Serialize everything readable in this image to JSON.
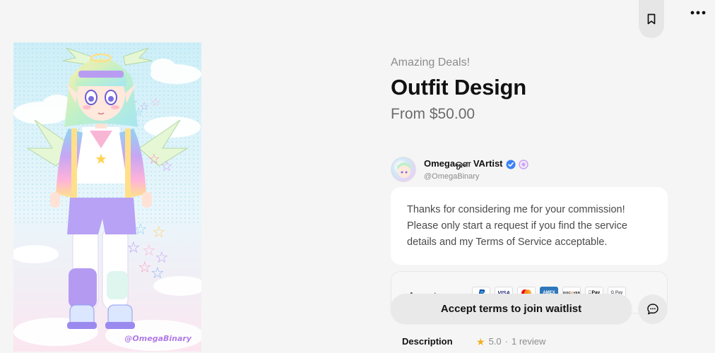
{
  "header": {
    "bookmark_icon": "bookmark-icon",
    "more_icon": "more-horizontal-icon"
  },
  "artwork": {
    "watermark": "@OmegaBinary"
  },
  "listing": {
    "eyebrow": "Amazing Deals!",
    "title": "Outfit Design",
    "price": "From $50.00"
  },
  "seller": {
    "name": "Omegaஔ VArtist",
    "handle": "@OmegaBinary",
    "verified_color": "#3b82f6",
    "badge_color": "#c9a2f2"
  },
  "message": {
    "line1": "Thanks for considering me for your commission!",
    "line2": "Please only start a request if you find the service",
    "line3": "details and my Terms of Service acceptable."
  },
  "accepts": {
    "label": "Accepts",
    "methods": [
      "PayPal",
      "VISA",
      "Mastercard",
      "AMEX",
      "DISCOVER",
      "Apple Pay",
      "G Pay"
    ]
  },
  "actions": {
    "waitlist_label": "Accept terms to join waitlist",
    "chat_icon": "chat-bubble-icon"
  },
  "tabs": {
    "description": "Description"
  },
  "rating": {
    "value": "5.0",
    "separator": "·",
    "reviews": "1 review",
    "star_color": "#f2b01e"
  }
}
